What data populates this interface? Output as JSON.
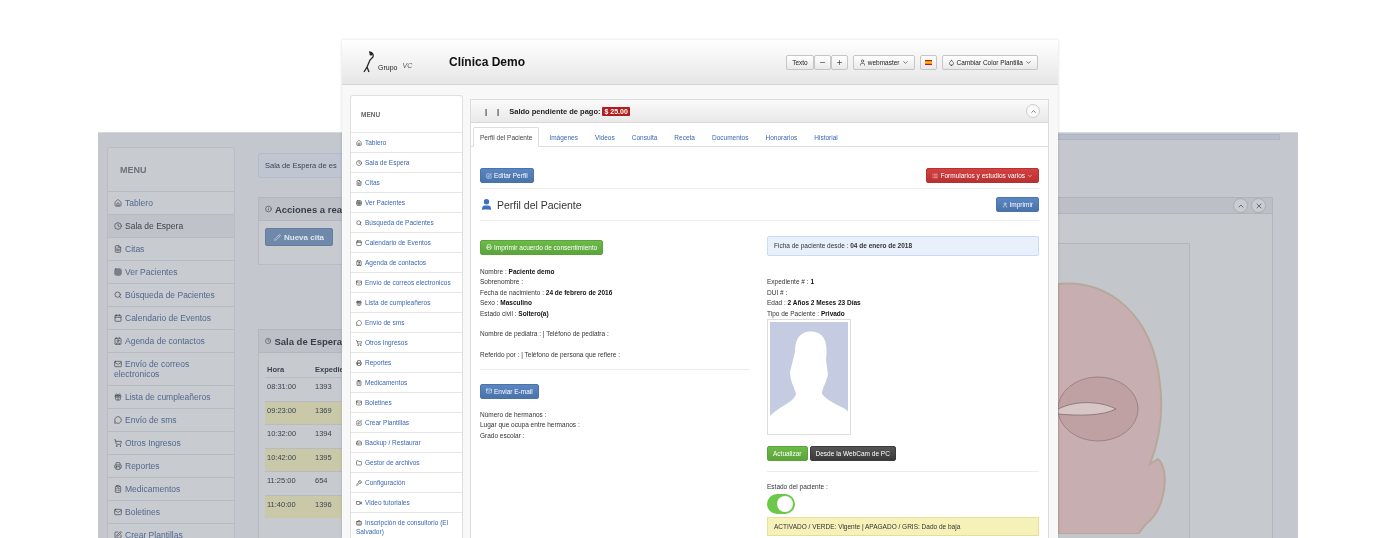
{
  "background_window": {
    "menu": {
      "title": "MENU",
      "items": [
        {
          "label": "Tablero",
          "selected": false
        },
        {
          "label": "Sala de Espera",
          "selected": true
        },
        {
          "label": "Citas",
          "selected": false
        },
        {
          "label": "Ver Pacientes",
          "selected": false
        },
        {
          "label": "Búsqueda de Pacientes",
          "selected": false
        },
        {
          "label": "Calendario de Eventos",
          "selected": false
        },
        {
          "label": "Agenda de contactos",
          "selected": false
        },
        {
          "label": "Envío de correos electronicos",
          "selected": false
        },
        {
          "label": "Lista de cumpleañeros",
          "selected": false
        },
        {
          "label": "Envío de sms",
          "selected": false
        },
        {
          "label": "Otros Ingresos",
          "selected": false
        },
        {
          "label": "Reportes",
          "selected": false
        },
        {
          "label": "Medicamentos",
          "selected": false
        },
        {
          "label": "Boletines",
          "selected": false
        },
        {
          "label": "Crear Plantillas",
          "selected": false
        }
      ]
    },
    "notice": "Sala de Espera de es",
    "actions_panel": {
      "title": "Acciones a rea",
      "button": "Nueva cita"
    },
    "waiting_panel": {
      "title": "Sala de Espera",
      "columns": [
        "Hora",
        "Expedie"
      ],
      "rows": [
        {
          "cells": [
            "08:31:00",
            "1393"
          ],
          "highlighted": false
        },
        {
          "cells": [
            "09:23:00",
            "1369"
          ],
          "highlighted": true
        },
        {
          "cells": [
            "10:32:00",
            "1394"
          ],
          "highlighted": false
        },
        {
          "cells": [
            "10:42:00",
            "1395"
          ],
          "highlighted": true
        },
        {
          "cells": [
            "11:25:00",
            "654"
          ],
          "highlighted": false
        },
        {
          "cells": [
            "11:40:00",
            "1396"
          ],
          "highlighted": true
        }
      ]
    }
  },
  "window": {
    "logo": {
      "word": "Grupo",
      "initials": "VC"
    },
    "title": "Clínica Demo",
    "toolbar": {
      "text_size_label": "Texto",
      "user": "webmaster",
      "theme": "Cambiar Color Plantilla"
    },
    "menu": {
      "title": "MENU",
      "items": [
        {
          "label": "Tablero",
          "selected": false
        },
        {
          "label": "Sala de Espera",
          "selected": false
        },
        {
          "label": "Citas",
          "selected": false
        },
        {
          "label": "Ver Pacientes",
          "selected": false
        },
        {
          "label": "Búsqueda de Pacientes",
          "selected": false
        },
        {
          "label": "Calendario de Eventos",
          "selected": false
        },
        {
          "label": "Agenda de contactos",
          "selected": false
        },
        {
          "label": "Envío de correos electronicos",
          "selected": false
        },
        {
          "label": "Lista de cumpleañeros",
          "selected": false
        },
        {
          "label": "Envío de sms",
          "selected": false
        },
        {
          "label": "Otros Ingresos",
          "selected": false
        },
        {
          "label": "Reportes",
          "selected": false
        },
        {
          "label": "Medicamentos",
          "selected": false
        },
        {
          "label": "Boletines",
          "selected": false
        },
        {
          "label": "Crear Plantillas",
          "selected": false
        },
        {
          "label": "Backup / Restaurar",
          "selected": false
        },
        {
          "label": "Gestor de archivos",
          "selected": false
        },
        {
          "label": "Configuración",
          "selected": false
        },
        {
          "label": "Video tutoriales",
          "selected": false
        },
        {
          "label": "Inscripción de consultorio (El Salvador)",
          "selected": false
        }
      ]
    },
    "panel": {
      "header_separators": [
        "|",
        "|"
      ],
      "balance_label": "Saldo pendiente de pago:",
      "balance": "$ 25.00",
      "tabs": [
        {
          "label": "Perfil del Paciente",
          "selected": true
        },
        {
          "label": "Imágenes",
          "selected": false
        },
        {
          "label": "Videos",
          "selected": false
        },
        {
          "label": "Consulta",
          "selected": false
        },
        {
          "label": "Receta",
          "selected": false
        },
        {
          "label": "Documentos",
          "selected": false
        },
        {
          "label": "Honorarios",
          "selected": false
        },
        {
          "label": "Historial",
          "selected": false
        }
      ],
      "edit_button": "Editar Perfil",
      "forms_button": "Formularios y estudios varios",
      "section_title": "Perfil del Paciente",
      "print_button": "Imprimir",
      "consent_button": "Imprimir acuerdo de consentimiento",
      "personal_info": [
        "Nombre : **Paciente demo**",
        "Sobrenombre :",
        "Fecha de nacimiento : **24 de febrero de 2016**",
        "Sexo : **Masculino**",
        "Estado civil : **Soltero(a)**"
      ],
      "referral_info": [
        "Nombre de pediatra : | Teléfono de pediatra :",
        "Referido por : | Teléfono de persona que refiere :"
      ],
      "email_button": "Enviar E-mail",
      "family_info": [
        "Número de hermanos :",
        "Lugar que ocupa entre hermanos :",
        "Grado escolar :"
      ],
      "since_notice": "Ficha de paciente desde : **04 de enero de 2018**",
      "record_info": [
        "Expediente # : **1**",
        "DUI # :",
        "Edad : **2 Años 2 Meses 23 Días**",
        "Tipo de Paciente : **Privado**"
      ],
      "photo_buttons": [
        {
          "label": "Actualizar",
          "kind": "success"
        },
        {
          "label": "Desde la WebCam de PC",
          "kind": "dark"
        }
      ],
      "status_label": "Estado del paciente :",
      "status_on": true,
      "status_legend": "ACTIVADO / VERDE: Vigente | APAGADO / GRIS: Dado de baja"
    }
  }
}
